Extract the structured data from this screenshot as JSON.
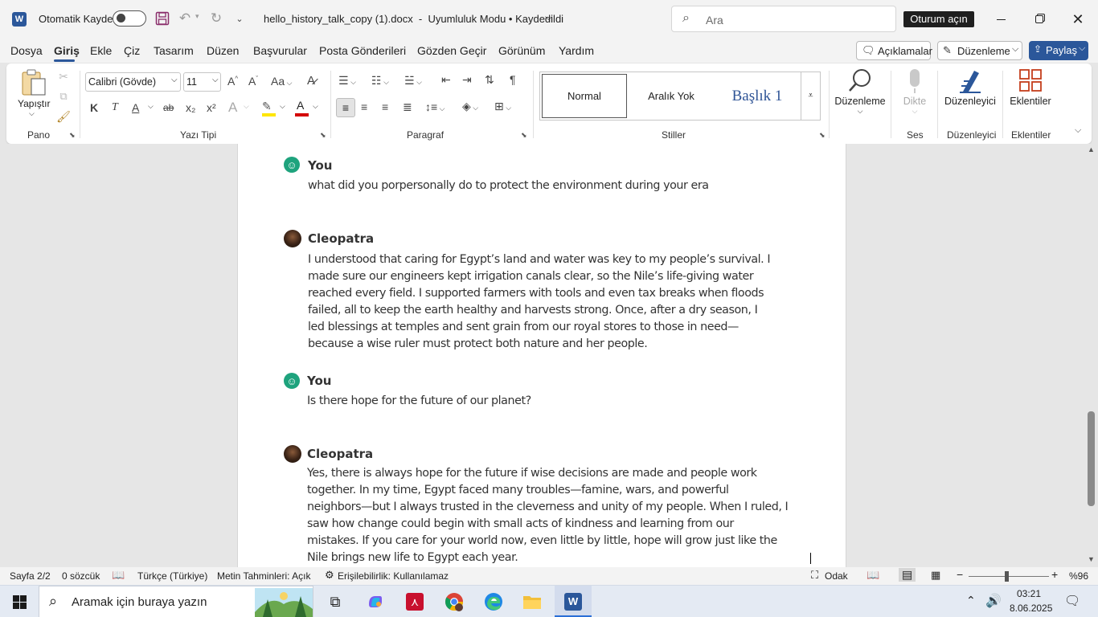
{
  "title": {
    "app_icon": "word-icon",
    "autosave_label": "Otomatik Kaydet",
    "autosave_state": "off",
    "doc_title": "hello_history_talk_copy (1).docx  -  Uyumluluk Modu • Kaydedildi",
    "search_placeholder": "Ara",
    "signin_label": "Oturum açın"
  },
  "menu": {
    "items": [
      "Dosya",
      "Giriş",
      "Ekle",
      "Çiz",
      "Tasarım",
      "Düzen",
      "Başvurular",
      "Posta Gönderileri",
      "Gözden Geçir",
      "Görünüm",
      "Yardım"
    ],
    "active": "Giriş",
    "comments_label": "Açıklamalar",
    "editing_label": "Düzenleme",
    "share_label": "Paylaş"
  },
  "ribbon": {
    "paste_label": "Yapıştır",
    "clipboard_group": "Pano",
    "font_name": "Calibri (Gövde)",
    "font_size": "11",
    "font_group": "Yazı Tipi",
    "paragraph_group": "Paragraf",
    "styles": [
      "Normal",
      "Aralık Yok",
      "Başlık 1"
    ],
    "styles_group": "Stiller",
    "editing_button": "Düzenleme",
    "dictate_button": "Dikte",
    "voice_group": "Ses",
    "editor_button": "Düzenleyici",
    "editor_group": "Düzenleyici",
    "addins_button": "Eklentiler",
    "addins_group": "Eklentiler",
    "bold": "K",
    "italic": "T",
    "underline": "A",
    "strike": "ab",
    "sub": "x₂",
    "sup": "x²",
    "accent_color": "#2b579a",
    "highlight_color": "#ffe600",
    "font_color": "#d40000"
  },
  "messages": [
    {
      "sender": "You",
      "avatar": "smiley-icon",
      "lines": [
        "what did you porpersonally do to protect the environment during your era"
      ]
    },
    {
      "sender": "Cleopatra",
      "avatar": "cleopatra-avatar",
      "lines": [
        "I understood that caring for Egypt’s land and water was key to my people’s survival. I",
        "made sure our engineers kept irrigation canals clear, so the Nile’s life-giving water",
        "reached every field. I supported farmers with tools and even tax breaks when floods",
        "failed, all to keep the earth healthy and harvests strong. Once, after a dry season, I",
        "led blessings at temples and sent grain from our royal stores to those in need—",
        "because a wise ruler must protect both nature and her people."
      ]
    },
    {
      "sender": "You",
      "avatar": "smiley-icon",
      "lines": [
        "Is there hope for the future of our planet?"
      ]
    },
    {
      "sender": "Cleopatra",
      "avatar": "cleopatra-avatar",
      "lines": [
        "Yes, there is always hope for the future if wise decisions are made and people work",
        "together. In my time, Egypt faced many troubles—famine, wars, and powerful",
        "neighbors—but I always trusted in the cleverness and unity of my people. When I ruled, I",
        "saw how change could begin with small acts of kindness and learning from our",
        "mistakes. If you care for your world now, even little by little, hope will grow just like the",
        "Nile brings new life to Egypt each year."
      ]
    }
  ],
  "status": {
    "page": "Sayfa 2/2",
    "words": "0 sözcük",
    "language": "Türkçe (Türkiye)",
    "predictions": "Metin Tahminleri: Açık",
    "accessibility": "Erişilebilirlik: Kullanılamaz",
    "focus": "Odak",
    "zoom": "%96"
  },
  "taskbar": {
    "search_placeholder": "Aramak için buraya yazın",
    "time": "03:21",
    "date": "8.06.2025",
    "apps": [
      "task-view-icon",
      "copilot-icon",
      "acrobat-icon",
      "chrome-icon",
      "edge-icon",
      "file-explorer-icon",
      "word-taskbar-icon"
    ]
  }
}
